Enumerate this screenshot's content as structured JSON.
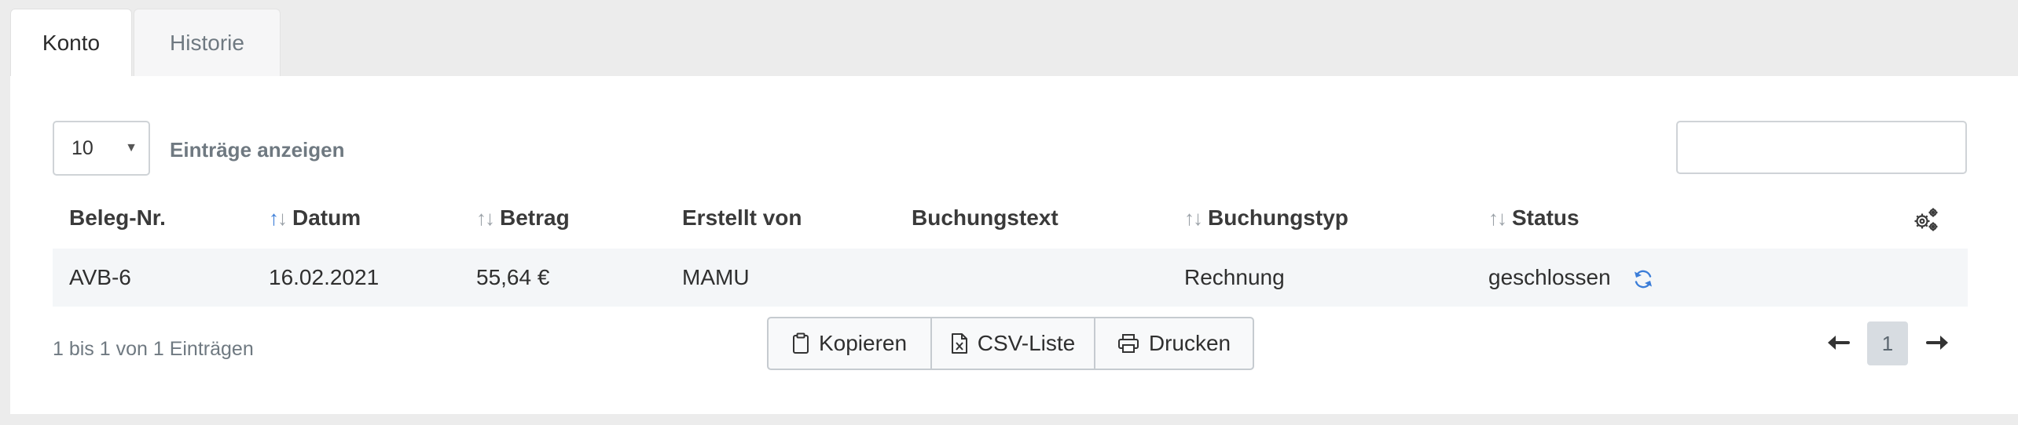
{
  "tabs": [
    {
      "label": "Konto",
      "active": true
    },
    {
      "label": "Historie",
      "active": false
    }
  ],
  "length": {
    "value": "10",
    "label": "Einträge anzeigen"
  },
  "search": {
    "value": "",
    "placeholder": ""
  },
  "table": {
    "columns": [
      "Beleg-Nr.",
      "Datum",
      "Betrag",
      "Erstellt von",
      "Buchungstext",
      "Buchungstyp",
      "Status"
    ],
    "rows": [
      {
        "beleg": "AVB-6",
        "datum": "16.02.2021",
        "betrag": "55,64 €",
        "erstellt": "MAMU",
        "text": "",
        "typ": "Rechnung",
        "status": "geschlossen"
      }
    ]
  },
  "info": "1 bis 1 von 1 Einträgen",
  "buttons": {
    "copy": "Kopieren",
    "csv": "CSV-Liste",
    "print": "Drucken"
  },
  "pagination": {
    "current": "1"
  },
  "colors": {
    "accent": "#3b7dd8",
    "muted": "#6f7981",
    "row_bg": "#f4f6f8"
  }
}
